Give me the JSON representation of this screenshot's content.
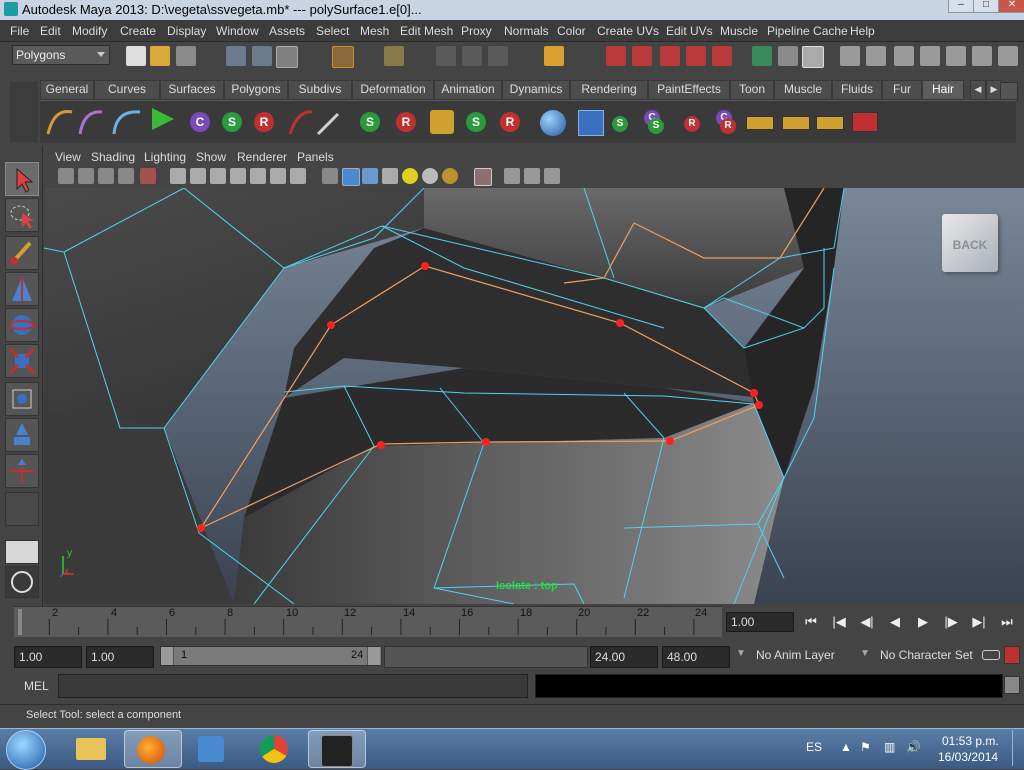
{
  "window": {
    "title": "Autodesk Maya 2013: D:\\vegeta\\ssvegeta.mb*   ---   polySurface1.e[0]...",
    "minimize": "–",
    "maximize": "□",
    "close": "✕"
  },
  "menubar": {
    "items": [
      "File",
      "Edit",
      "Modify",
      "Create",
      "Display",
      "Window",
      "Assets",
      "Select",
      "Mesh",
      "Edit Mesh",
      "Proxy",
      "Normals",
      "Color",
      "Create UVs",
      "Edit UVs",
      "Muscle",
      "Pipeline Cache",
      "Help"
    ]
  },
  "statusline": {
    "mode": "Polygons"
  },
  "shelf": {
    "tabs": [
      "General",
      "Curves",
      "Surfaces",
      "Polygons",
      "Subdivs",
      "Deformation",
      "Animation",
      "Dynamics",
      "Rendering",
      "PaintEffects",
      "Toon",
      "Muscle",
      "Fluids",
      "Fur",
      "Hair"
    ],
    "active_tab": "Hair",
    "ball_labels": [
      "S",
      "R",
      "S",
      "R",
      "S",
      "R",
      "S",
      "S",
      "R",
      "C",
      "R",
      "S",
      "R",
      "R",
      "S"
    ]
  },
  "panel": {
    "menus": [
      "View",
      "Shading",
      "Lighting",
      "Show",
      "Renderer",
      "Panels"
    ]
  },
  "viewport": {
    "viewcube_label": "BACK",
    "hud_isolate": "Isolate : top",
    "axis_x": "x",
    "axis_y": "y",
    "wire_color": "#4fd3f0",
    "selected_edge_color": "#f0a060",
    "vertex_color": "#ff2020"
  },
  "timeline": {
    "ticks": [
      "2",
      "4",
      "6",
      "8",
      "10",
      "12",
      "14",
      "16",
      "18",
      "20",
      "22",
      "24"
    ],
    "current_frame": "1.00",
    "playback": [
      "⏮",
      "|◀",
      "◀|",
      "◀",
      "▶",
      "|▶",
      "▶|",
      "⏭"
    ]
  },
  "range": {
    "start": "1.00",
    "playback_start": "1.00",
    "slider_start": "1",
    "slider_end": "24",
    "playback_end": "24.00",
    "end": "48.00",
    "anim_layer": "No Anim Layer",
    "character_set": "No Character Set"
  },
  "cmdline": {
    "label": "MEL"
  },
  "helpline": {
    "text": "Select Tool: select a component"
  },
  "taskbar": {
    "lang": "ES",
    "time": "01:53 p.m.",
    "date": "16/03/2014"
  }
}
